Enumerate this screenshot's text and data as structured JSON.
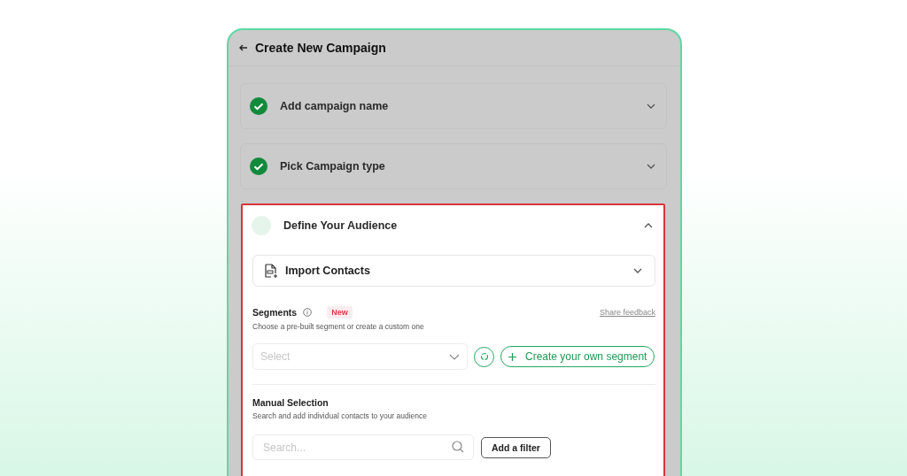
{
  "header": {
    "title": "Create New Campaign"
  },
  "steps": [
    {
      "title": "Add campaign name",
      "done": true,
      "expanded": false,
      "highlighted": false
    },
    {
      "title": "Pick Campaign type",
      "done": true,
      "expanded": false,
      "highlighted": false
    },
    {
      "title": "Define Your Audience",
      "done": false,
      "expanded": true,
      "highlighted": true
    }
  ],
  "import": {
    "label": "Import Contacts",
    "expanded": false
  },
  "segments": {
    "title": "Segments",
    "badge": "New",
    "link": "Share feedback",
    "description": "Choose a pre-built segment or create a custom one",
    "select_placeholder": "Select",
    "create_button": "Create your own segment"
  },
  "manual": {
    "title": "Manual Selection",
    "description": "Search and add individual contacts to your audience",
    "search_placeholder": "Search...",
    "filter_button": "Add a filter"
  }
}
